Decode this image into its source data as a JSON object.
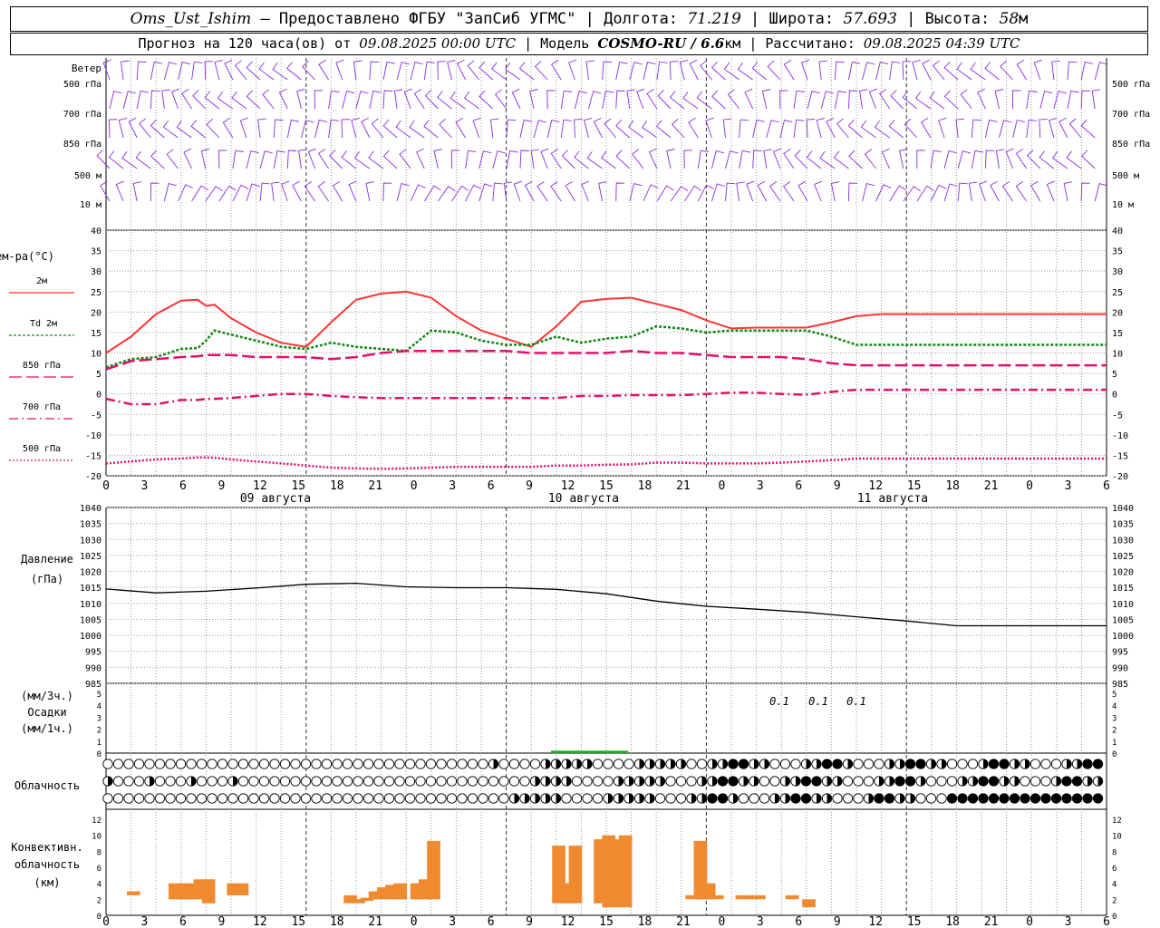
{
  "header": {
    "station": "Oms_Ust_Ishim",
    "dash": " – ",
    "provider": "Предоставлено ФГБУ \"ЗапСиб УГМС\"",
    "lon_label": "Долгота:",
    "lon": "71.219",
    "lat_label": "Широта:",
    "lat": "57.693",
    "alt_label": "Высота:",
    "alt": "58",
    "alt_unit": "м",
    "sep": " | ",
    "forecast_label": "Прогноз на 120 часа(ов) от",
    "start": "09.08.2025 00:00 UTC",
    "model_label": "Модель",
    "model": "COSMO-RU / 6.6",
    "model_unit": "км",
    "calc_label": "Рассчитано:",
    "calc": "09.08.2025 04:39 UTC"
  },
  "colors": {
    "t2m": "#ff3333",
    "td2m": "#118811",
    "t850": "#e0116b",
    "t700": "#e0116b",
    "t500": "#e0116b",
    "wind": "#8a2be2",
    "convective": "#f08a30",
    "precip": "#22aa22",
    "pressure": "#000000",
    "grid": "#888888"
  },
  "wind_panel": {
    "title": "Ветер",
    "levels": [
      "500 гПа",
      "700 гПа",
      "850 гПа",
      "500 м",
      "10 м"
    ]
  },
  "temp_panel": {
    "title": "Тем-ра(°С)",
    "legend": [
      {
        "label": "2м",
        "key": "t2m",
        "dash": ""
      },
      {
        "label": "Td 2м",
        "key": "td2m",
        "dash": "3,2"
      },
      {
        "label": "850 гПа",
        "key": "t850",
        "dash": "14,5"
      },
      {
        "label": "700 гПа",
        "key": "t700",
        "dash": "10,4,2,4"
      },
      {
        "label": "500 гПа",
        "key": "t500",
        "dash": "2,2"
      }
    ],
    "ticks": [
      "40",
      "35",
      "30",
      "25",
      "20",
      "15",
      "10",
      "5",
      "0",
      "-5",
      "-10",
      "-15",
      "-20"
    ]
  },
  "hour_labels": [
    "0",
    "3",
    "6",
    "9",
    "12",
    "15",
    "18",
    "21",
    "0",
    "3",
    "6",
    "9",
    "12",
    "15",
    "18",
    "21",
    "0",
    "3",
    "6",
    "9",
    "12",
    "15",
    "18",
    "21",
    "0",
    "3",
    "6"
  ],
  "day_labels": [
    "09 августа",
    "10 августа",
    "11 августа"
  ],
  "pressure_panel": {
    "title": "Давление",
    "unit": "(гПа)",
    "ticks": [
      "1040",
      "1035",
      "1030",
      "1025",
      "1020",
      "1015",
      "1010",
      "1005",
      "1000",
      "995",
      "990",
      "985"
    ]
  },
  "precip_panel": {
    "unit3": "(мм/3ч.)",
    "title": "Осадки",
    "unit1": "(мм/1ч.)",
    "ticks": [
      "5",
      "4",
      "3",
      "2",
      "1",
      "0"
    ],
    "annotations": [
      "0.1",
      "0.1",
      "0.1"
    ]
  },
  "cloud_panel": {
    "title": "Облачность"
  },
  "conv_panel": {
    "title1": "Конвективн.",
    "title2": "облачность",
    "unit": "(км)",
    "ticks": [
      "12",
      "10",
      "8",
      "6",
      "4",
      "2",
      "0"
    ]
  },
  "chart_data": [
    {
      "type": "line",
      "title": "Тем-ра(°С)",
      "x_hours": [
        0,
        3,
        6,
        9,
        11,
        12,
        13,
        15,
        18,
        21,
        24,
        27,
        30,
        33,
        36,
        39,
        42,
        45,
        48,
        51,
        54,
        57,
        60,
        63,
        66,
        69,
        72,
        75,
        78,
        81,
        84,
        87,
        90,
        93,
        96,
        99,
        102,
        105,
        108,
        111,
        114,
        117,
        120
      ],
      "ylim": [
        -20,
        40
      ],
      "series": [
        {
          "name": "2м",
          "values": [
            10,
            14,
            19.5,
            22.8,
            23,
            21.5,
            21.8,
            18.5,
            15,
            12.5,
            11.5,
            17.5,
            23,
            24.5,
            25,
            23.5,
            19,
            15.5,
            13.5,
            11.5,
            16.5,
            22.5,
            23.2,
            23.5,
            22,
            20.5,
            18,
            16,
            16.2,
            16.2,
            16.2,
            17.5,
            19,
            19.5,
            19.5,
            19.5,
            19.5,
            19.5,
            19.5,
            19.5,
            19.5,
            19.5,
            19.5
          ]
        },
        {
          "name": "Td 2м",
          "values": [
            6.5,
            8.5,
            9,
            11,
            11.2,
            13,
            15.5,
            14.5,
            13,
            11.5,
            11,
            12.5,
            11.5,
            11,
            10.5,
            15.5,
            15,
            13,
            12,
            12,
            14,
            12.5,
            13.5,
            14,
            16.5,
            16,
            15,
            15.5,
            15.5,
            15.5,
            15.5,
            14,
            12,
            12,
            12,
            12,
            12,
            12,
            12,
            12,
            12,
            12,
            12
          ]
        },
        {
          "name": "850 гПа",
          "values": [
            6,
            8,
            8.5,
            9,
            9.2,
            9.5,
            9.5,
            9.5,
            9,
            9,
            9,
            8.5,
            9,
            10,
            10.5,
            10.5,
            10.5,
            10.5,
            10.5,
            10,
            10,
            10,
            10,
            10.5,
            10,
            10,
            9.5,
            9,
            9,
            9,
            8.5,
            7.5,
            7,
            7,
            7,
            7,
            7,
            7,
            7,
            7,
            7,
            7,
            7
          ]
        },
        {
          "name": "700 гПа",
          "values": [
            -1.2,
            -2.5,
            -2.5,
            -1.5,
            -1.5,
            -1.2,
            -1.2,
            -1,
            -0.5,
            0,
            0,
            -0.5,
            -0.8,
            -1,
            -1,
            -1,
            -1,
            -1,
            -1,
            -1,
            -1,
            -0.5,
            -0.5,
            -0.3,
            -0.3,
            -0.3,
            0,
            0.3,
            0.3,
            0,
            -0.2,
            0.5,
            1,
            1,
            1,
            1,
            1,
            1,
            1,
            1,
            1,
            1,
            1
          ]
        },
        {
          "name": "500 гПа",
          "values": [
            -17,
            -16.5,
            -16,
            -15.8,
            -15.5,
            -15.5,
            -15.6,
            -16,
            -16.5,
            -17,
            -17.5,
            -18,
            -18.2,
            -18.3,
            -18.2,
            -18,
            -17.8,
            -17.8,
            -17.8,
            -17.8,
            -17.5,
            -17.5,
            -17.3,
            -17.2,
            -16.8,
            -16.8,
            -17,
            -17,
            -17,
            -16.8,
            -16.5,
            -16.2,
            -15.8,
            -15.8,
            -15.8,
            -15.8,
            -15.8,
            -15.8,
            -15.8,
            -15.8,
            -15.8,
            -15.8,
            -15.8
          ]
        }
      ]
    },
    {
      "type": "line",
      "title": "Давление",
      "ylabel": "(гПа)",
      "ylim": [
        985,
        1040
      ],
      "x_hours": [
        0,
        6,
        12,
        18,
        24,
        30,
        36,
        42,
        48,
        54,
        60,
        66,
        72,
        78,
        84,
        90,
        96,
        102,
        108,
        114,
        120
      ],
      "values": [
        1014.5,
        1013.3,
        1013.8,
        1014.8,
        1016.0,
        1016.3,
        1015.2,
        1014.9,
        1014.9,
        1014.4,
        1013.0,
        1010.7,
        1009.1,
        1008.2,
        1007.2,
        1005.8,
        1004.5,
        1003.0,
        1003.0,
        1003.0,
        1003.0
      ]
    },
    {
      "type": "bar",
      "title": "Конвективн. облачность",
      "ylabel": "(км)",
      "ylim": [
        0,
        13
      ],
      "bars": [
        {
          "h": 3,
          "base": 2.5,
          "top": 3
        },
        {
          "h": 8,
          "base": 2,
          "top": 4
        },
        {
          "h": 9,
          "base": 2,
          "top": 4
        },
        {
          "h": 10,
          "base": 2,
          "top": 4
        },
        {
          "h": 11,
          "base": 2,
          "top": 4.5
        },
        {
          "h": 12,
          "base": 1.5,
          "top": 4.5
        },
        {
          "h": 15,
          "base": 2.5,
          "top": 4
        },
        {
          "h": 16,
          "base": 2.5,
          "top": 4
        },
        {
          "h": 29,
          "base": 1.5,
          "top": 2.5
        },
        {
          "h": 30,
          "base": 1.5,
          "top": 2
        },
        {
          "h": 31,
          "base": 1.8,
          "top": 2.2
        },
        {
          "h": 32,
          "base": 2,
          "top": 3
        },
        {
          "h": 33,
          "base": 2,
          "top": 3.5
        },
        {
          "h": 34,
          "base": 2,
          "top": 3.8
        },
        {
          "h": 35,
          "base": 2,
          "top": 4
        },
        {
          "h": 37,
          "base": 2,
          "top": 4
        },
        {
          "h": 38,
          "base": 2,
          "top": 4.5
        },
        {
          "h": 39,
          "base": 2,
          "top": 9.3
        },
        {
          "h": 54,
          "base": 1.5,
          "top": 8.7
        },
        {
          "h": 55,
          "base": 1.5,
          "top": 4
        },
        {
          "h": 56,
          "base": 1.5,
          "top": 8.7
        },
        {
          "h": 59,
          "base": 1.5,
          "top": 9.5
        },
        {
          "h": 60,
          "base": 1,
          "top": 10
        },
        {
          "h": 61,
          "base": 1,
          "top": 9.5
        },
        {
          "h": 62,
          "base": 1,
          "top": 10
        },
        {
          "h": 70,
          "base": 2,
          "top": 2.5
        },
        {
          "h": 71,
          "base": 2,
          "top": 9.3
        },
        {
          "h": 72,
          "base": 2,
          "top": 4
        },
        {
          "h": 73,
          "base": 2,
          "top": 2.5
        },
        {
          "h": 76,
          "base": 2,
          "top": 2.5
        },
        {
          "h": 77,
          "base": 2,
          "top": 2.5
        },
        {
          "h": 78,
          "base": 2,
          "top": 2.5
        },
        {
          "h": 82,
          "base": 2,
          "top": 2.5
        },
        {
          "h": 84,
          "base": 1,
          "top": 2
        }
      ]
    },
    {
      "type": "bar",
      "title": "Осадки",
      "ylim": [
        0,
        5
      ],
      "bars": [
        {
          "h": 55,
          "value": 0.1
        },
        {
          "h": 58,
          "value": 0.1
        },
        {
          "h": 61,
          "value": 0.1
        }
      ]
    }
  ]
}
